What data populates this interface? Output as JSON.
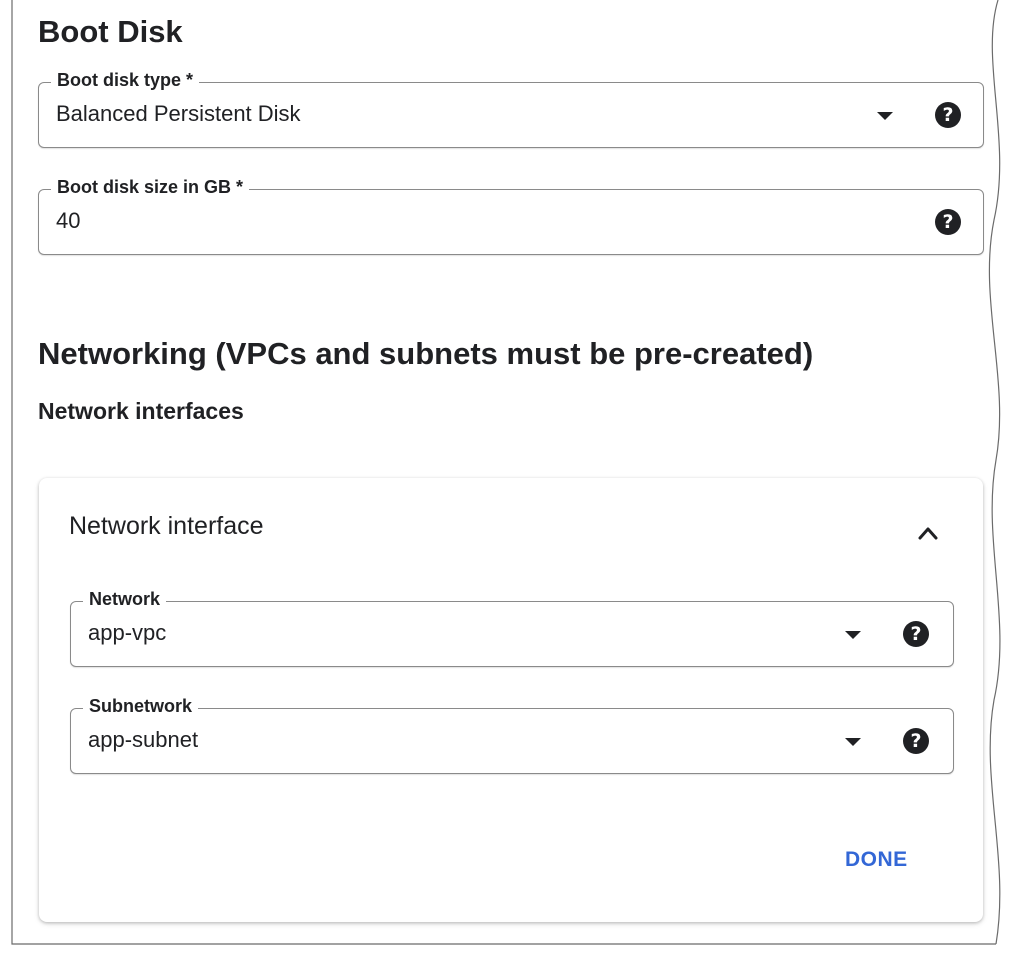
{
  "boot_disk": {
    "title": "Boot Disk",
    "type_field": {
      "label": "Boot disk type *",
      "value": "Balanced Persistent Disk"
    },
    "size_field": {
      "label": "Boot disk size in GB *",
      "value": "40"
    }
  },
  "networking": {
    "title": "Networking (VPCs and subnets must be pre-created)",
    "subtitle": "Network interfaces",
    "card": {
      "title": "Network interface",
      "network_field": {
        "label": "Network",
        "value": "app-vpc"
      },
      "subnetwork_field": {
        "label": "Subnetwork",
        "value": "app-subnet"
      },
      "done_label": "DONE"
    }
  },
  "icons": {
    "help": "help-circle-icon",
    "dropdown": "dropdown-arrow-icon",
    "collapse": "chevron-up-icon"
  },
  "colors": {
    "accent": "#3367d6",
    "text": "#202124",
    "border": "#8a8a8a"
  }
}
